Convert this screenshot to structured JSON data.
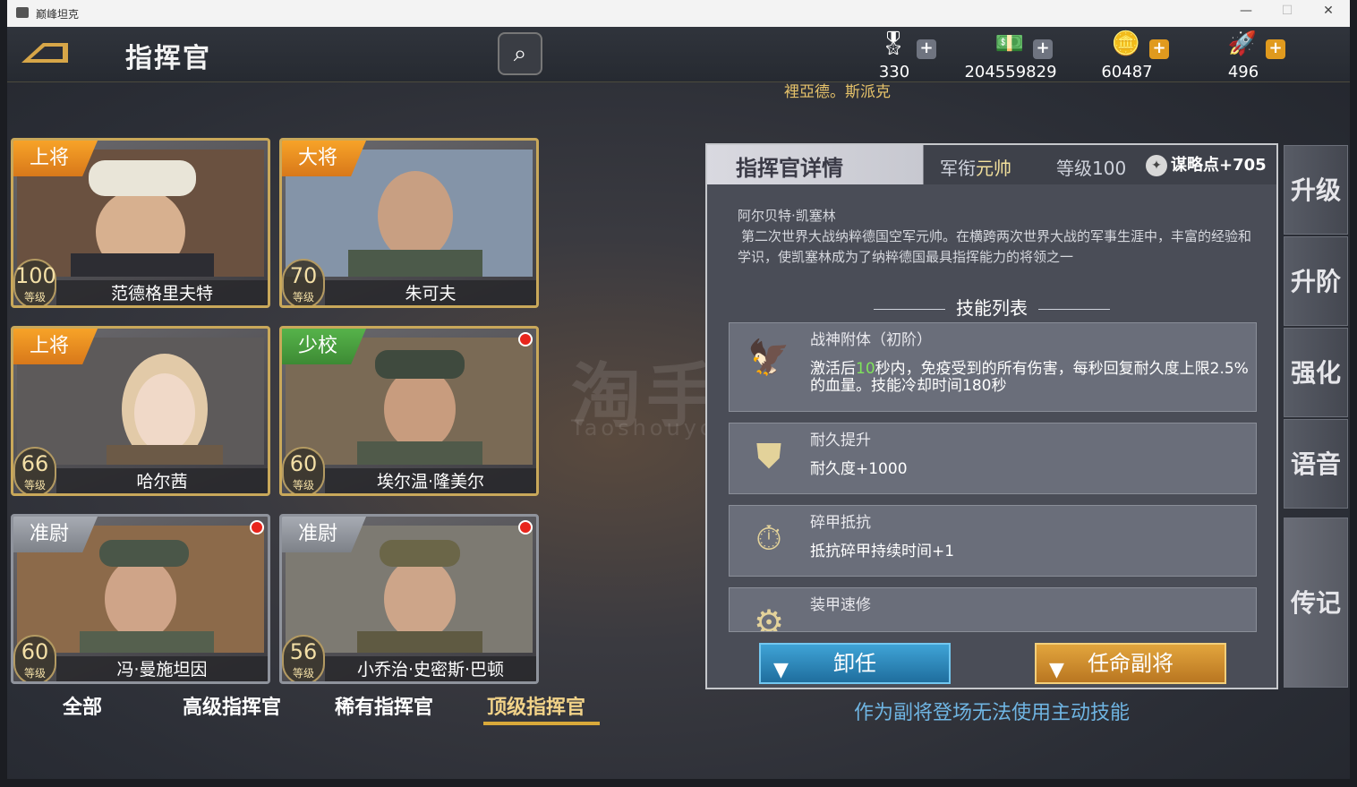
{
  "window": {
    "title": "巅峰坦克"
  },
  "header": {
    "title": "指挥官",
    "search_icon": "⌕"
  },
  "resources": [
    {
      "name": "medal",
      "value": "330",
      "icon": "🎖",
      "plus": "+",
      "plus_color": "#6f7480"
    },
    {
      "name": "cash",
      "value": "204559829",
      "icon": "💵",
      "plus": "+",
      "plus_color": "#6f7480"
    },
    {
      "name": "gold",
      "value": "60487",
      "icon": "🪙",
      "plus": "+",
      "plus_color": "#e09a1e"
    },
    {
      "name": "rocket",
      "value": "496",
      "icon": "🚀",
      "plus": "+",
      "plus_color": "#e09a1e"
    }
  ],
  "owner_name": "裡亞德。斯派克",
  "commanders": [
    {
      "rank": "上将",
      "rank_color": "orange",
      "level": "100",
      "level_label": "等级",
      "name": "范德格里夫特",
      "badge": false,
      "border": "gold"
    },
    {
      "rank": "大将",
      "rank_color": "orange",
      "level": "70",
      "level_label": "等级",
      "name": "朱可夫",
      "badge": false,
      "border": "gold"
    },
    {
      "rank": "上将",
      "rank_color": "orange",
      "level": "66",
      "level_label": "等级",
      "name": "哈尔茜",
      "badge": false,
      "border": "gold"
    },
    {
      "rank": "少校",
      "rank_color": "green",
      "level": "60",
      "level_label": "等级",
      "name": "埃尔温·隆美尔",
      "badge": true,
      "border": "gold"
    },
    {
      "rank": "准尉",
      "rank_color": "gray",
      "level": "60",
      "level_label": "等级",
      "name": "冯·曼施坦因",
      "badge": true,
      "border": "gray"
    },
    {
      "rank": "准尉",
      "rank_color": "gray",
      "level": "56",
      "level_label": "等级",
      "name": "小乔治·史密斯·巴顿",
      "badge": true,
      "border": "gray"
    }
  ],
  "tabs": [
    "全部",
    "高级指挥官",
    "稀有指挥官",
    "顶级指挥官"
  ],
  "active_tab": "顶级指挥官",
  "detail": {
    "title": "指挥官详情",
    "rank_label": "军衔",
    "rank_value": "元帅",
    "level_label": "等级",
    "level_value": "100",
    "strategy": "谋略点+705",
    "commander_name": "阿尔贝特·凯塞林",
    "bio": "第二次世界大战纳粹德国空军元帅。在横跨两次世界大战的军事生涯中，丰富的经验和学识，使凯塞林成为了纳粹德国最具指挥能力的将领之一",
    "skills_heading": "技能列表",
    "skills": [
      {
        "name": "战神附体（初阶）",
        "icon": "🦅",
        "effect_pre": "激活后",
        "effect_highlight": "10",
        "effect_post": "秒内，免疫受到的所有伤害，每秒回复耐久度上限2.5%的血量。技能冷却时间180秒"
      },
      {
        "name": "耐久提升",
        "icon": "⛊",
        "effect_pre": "耐久度+1000",
        "effect_highlight": "",
        "effect_post": ""
      },
      {
        "name": "碎甲抵抗",
        "icon": "⏱",
        "effect_pre": "抵抗碎甲持续时间+1",
        "effect_highlight": "",
        "effect_post": ""
      },
      {
        "name": "装甲速修",
        "icon": "⚙",
        "effect_pre": "",
        "effect_highlight": "",
        "effect_post": ""
      }
    ],
    "dismiss_button": "卸任",
    "appoint_button": "任命副将",
    "note": "作为副将登场无法使用主动技能"
  },
  "side_tabs": [
    "升级",
    "升阶",
    "强化",
    "语音",
    "传记"
  ],
  "active_side_tab": "传记",
  "watermark": {
    "main": "淘手游",
    "sub": "Taoshouyou.Com"
  }
}
